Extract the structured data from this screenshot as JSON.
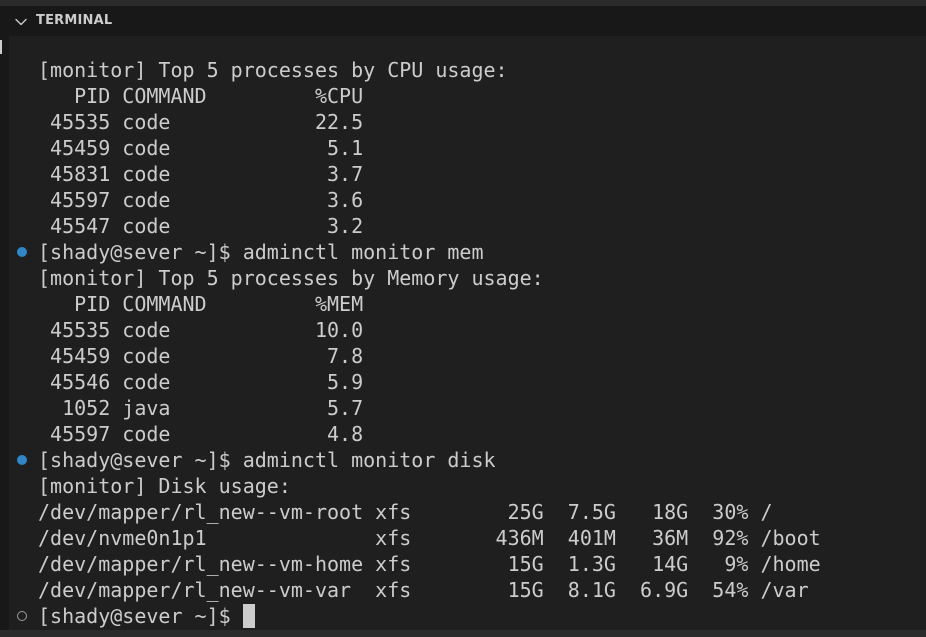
{
  "panel": {
    "title": "TERMINAL"
  },
  "terminal": {
    "lines": [
      {
        "text": "[monitor] Top 5 processes by CPU usage:",
        "deco": "none"
      },
      {
        "text": "   PID COMMAND         %CPU",
        "deco": "none"
      },
      {
        "text": " 45535 code            22.5",
        "deco": "none"
      },
      {
        "text": " 45459 code             5.1",
        "deco": "none"
      },
      {
        "text": " 45831 code             3.7",
        "deco": "none"
      },
      {
        "text": " 45597 code             3.6",
        "deco": "none"
      },
      {
        "text": " 45547 code             3.2",
        "deco": "none"
      },
      {
        "text": "[shady@sever ~]$ adminctl monitor mem",
        "deco": "done"
      },
      {
        "text": "[monitor] Top 5 processes by Memory usage:",
        "deco": "none"
      },
      {
        "text": "   PID COMMAND         %MEM",
        "deco": "none"
      },
      {
        "text": " 45535 code            10.0",
        "deco": "none"
      },
      {
        "text": " 45459 code             7.8",
        "deco": "none"
      },
      {
        "text": " 45546 code             5.9",
        "deco": "none"
      },
      {
        "text": "  1052 java             5.7",
        "deco": "none"
      },
      {
        "text": " 45597 code             4.8",
        "deco": "none"
      },
      {
        "text": "[shady@sever ~]$ adminctl monitor disk",
        "deco": "done"
      },
      {
        "text": "[monitor] Disk usage:",
        "deco": "none"
      },
      {
        "text": "/dev/mapper/rl_new--vm-root xfs        25G  7.5G   18G  30% /",
        "deco": "none"
      },
      {
        "text": "/dev/nvme0n1p1              xfs       436M  401M   36M  92% /boot",
        "deco": "none"
      },
      {
        "text": "/dev/mapper/rl_new--vm-home xfs        15G  1.3G   14G   9% /home",
        "deco": "none"
      },
      {
        "text": "/dev/mapper/rl_new--vm-var  xfs        15G  8.1G  6.9G  54% /var",
        "deco": "none"
      }
    ],
    "prompt": {
      "text": "[shady@sever ~]$",
      "deco": "pending"
    }
  },
  "colors": {
    "background": "#1f1f1f",
    "header_background": "#181818",
    "text": "#cccccc",
    "success_decoration": "#2f86c8"
  },
  "icons": {
    "collapse": "chevron-down-icon",
    "command_success": "circle-filled-icon",
    "command_pending": "circle-outline-icon"
  }
}
